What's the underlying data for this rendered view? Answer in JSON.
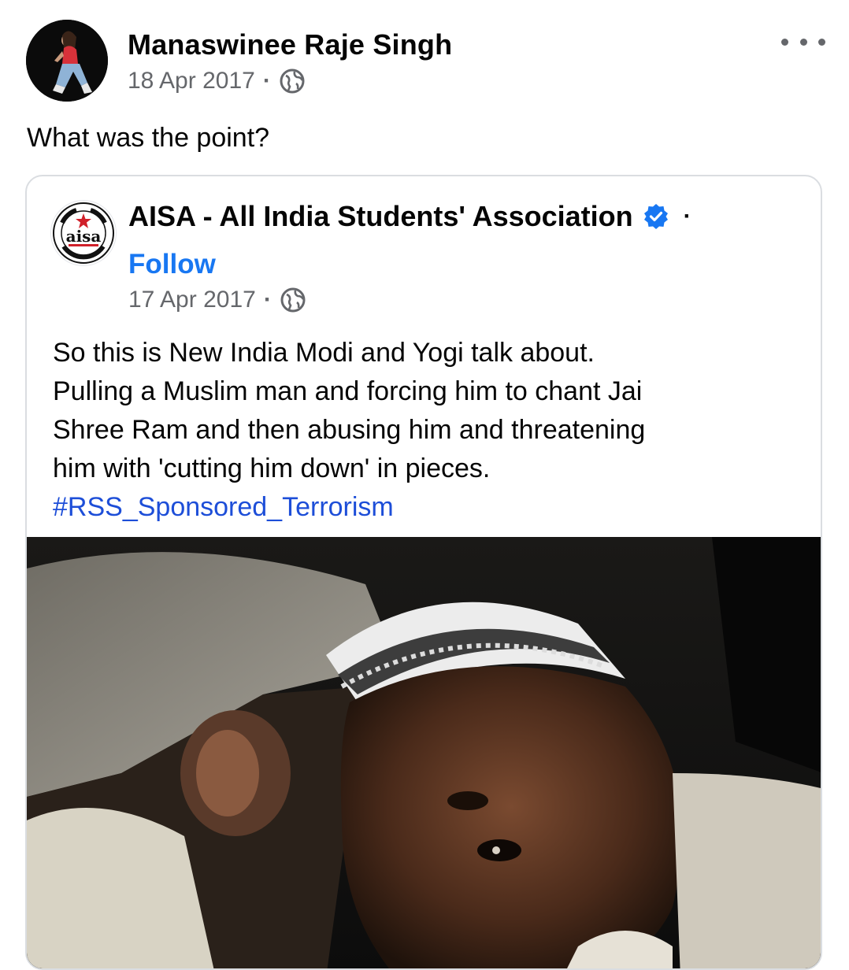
{
  "post": {
    "author": "Manaswinee Raje Singh",
    "date": "18 Apr 2017",
    "separator": "·",
    "audience_icon": "globe-icon",
    "more_icon": "more-options-icon",
    "text": "What was the point?"
  },
  "shared_post": {
    "page_name": "AISA - All India Students' Association",
    "verified_icon": "verified-badge-icon",
    "name_separator": "·",
    "follow_label": "Follow",
    "date": "17 Apr 2017",
    "separator": "·",
    "audience_icon": "globe-icon",
    "body_lines": [
      "So this is New India Modi and Yogi talk about.",
      "Pulling a Muslim man and forcing him to chant Jai",
      "Shree Ram and then abusing him and threatening",
      "him with 'cutting him down' in pieces."
    ],
    "hashtag": "#RSS_Sponsored_Terrorism",
    "logo_text": "aisa"
  },
  "colors": {
    "link_blue": "#1877f2",
    "meta_gray": "#65676b",
    "border": "#dadde1"
  }
}
